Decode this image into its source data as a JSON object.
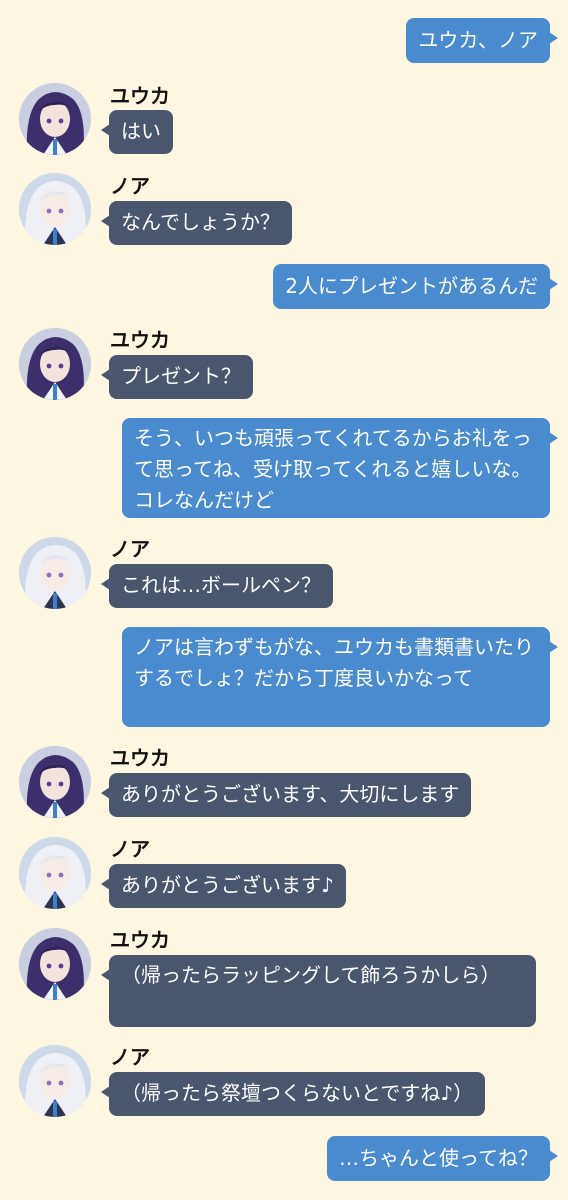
{
  "chat": {
    "messages": [
      {
        "side": "sent",
        "text": "ユウカ、ノア"
      },
      {
        "side": "recv",
        "speaker": "yuuka",
        "name": "ユウカ",
        "text": "はい"
      },
      {
        "side": "recv",
        "speaker": "noa",
        "name": "ノア",
        "text": "なんでしょうか？"
      },
      {
        "side": "sent",
        "text": "2人にプレゼントがあるんだ"
      },
      {
        "side": "recv",
        "speaker": "yuuka",
        "name": "ユウカ",
        "text": "プレゼント？"
      },
      {
        "side": "sent",
        "text": "そう、いつも頑張ってくれてるからお礼をって思ってね、受け取ってくれると嬉しいな。コレなんだけど"
      },
      {
        "side": "recv",
        "speaker": "noa",
        "name": "ノア",
        "text": "これは…ボールペン？"
      },
      {
        "side": "sent",
        "text": "ノアは言わずもがな、ユウカも書類書いたりするでしょ？だから丁度良いかなって"
      },
      {
        "side": "recv",
        "speaker": "yuuka",
        "name": "ユウカ",
        "text": "ありがとうございます、大切にします"
      },
      {
        "side": "recv",
        "speaker": "noa",
        "name": "ノア",
        "text": "ありがとうございます♪"
      },
      {
        "side": "recv",
        "speaker": "yuuka",
        "name": "ユウカ",
        "text": "（帰ったらラッピングして飾ろうかしら）"
      },
      {
        "side": "recv",
        "speaker": "noa",
        "name": "ノア",
        "text": "（帰ったら祭壇つくらないとですね♪）"
      },
      {
        "side": "sent",
        "text": "…ちゃんと使ってね？"
      }
    ]
  },
  "colors": {
    "background": "#fdf6e1",
    "sent_bubble": "#4a8bcf",
    "received_bubble": "#4a566d",
    "name_text": "#111111"
  },
  "icons": {
    "yuuka_avatar": "avatar-yuuka-icon",
    "noa_avatar": "avatar-noa-icon"
  }
}
